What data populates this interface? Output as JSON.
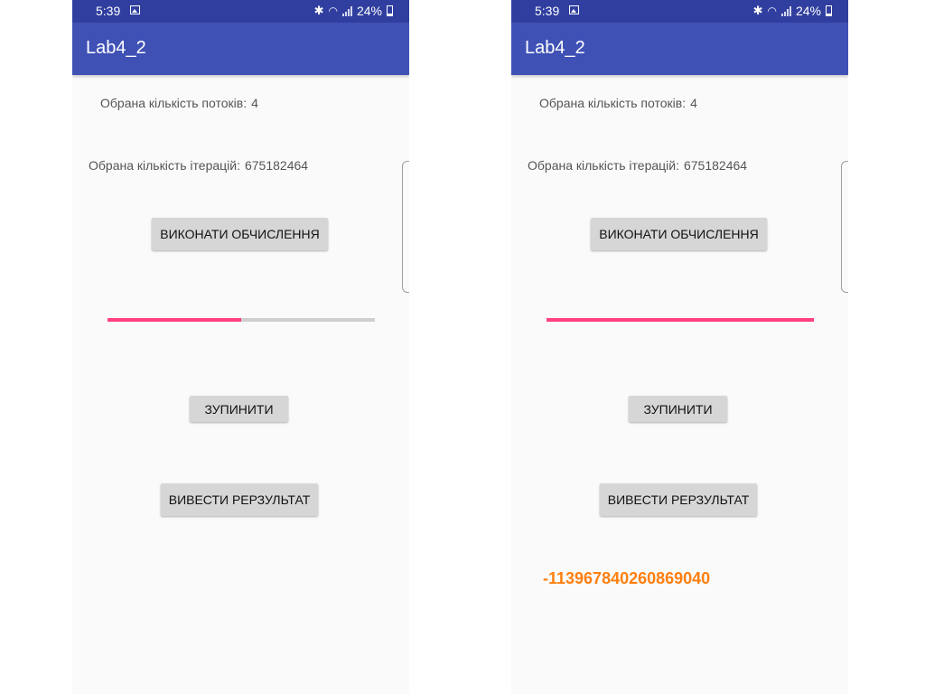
{
  "screens": [
    {
      "status": {
        "time": "5:39",
        "battery": "24%"
      },
      "app_title": "Lab4_2",
      "threads_label": "Обрана кількість потоків:",
      "threads_value": "4",
      "iterations_label": "Обрана кількість ітерацій:",
      "iterations_value": "675182464",
      "compute_button": "ВИКОНАТИ ОБЧИСЛЕННЯ",
      "progress_fraction": 0.5,
      "stop_button": "ЗУПИНИТИ",
      "output_button": "ВИВЕСТИ РЕРЗУЛЬТАТ",
      "result": ""
    },
    {
      "status": {
        "time": "5:39",
        "battery": "24%"
      },
      "app_title": "Lab4_2",
      "threads_label": "Обрана кількість потоків:",
      "threads_value": "4",
      "iterations_label": "Обрана кількість ітерацій:",
      "iterations_value": "675182464",
      "compute_button": "ВИКОНАТИ ОБЧИСЛЕННЯ",
      "progress_fraction": 1.0,
      "stop_button": "ЗУПИНИТИ",
      "output_button": "ВИВЕСТИ РЕРЗУЛЬТАТ",
      "result": "-113967840260869040"
    }
  ],
  "colors": {
    "status_bar": "#303f9f",
    "app_bar": "#3f51b5",
    "progress_fill": "#ff4081",
    "progress_track": "#cfcfcf",
    "result_text": "#ff7f0e",
    "button_bg": "#d6d6d6"
  },
  "icons": [
    "image-icon",
    "bluetooth-icon",
    "wifi-icon",
    "signal-icon",
    "battery-icon"
  ]
}
